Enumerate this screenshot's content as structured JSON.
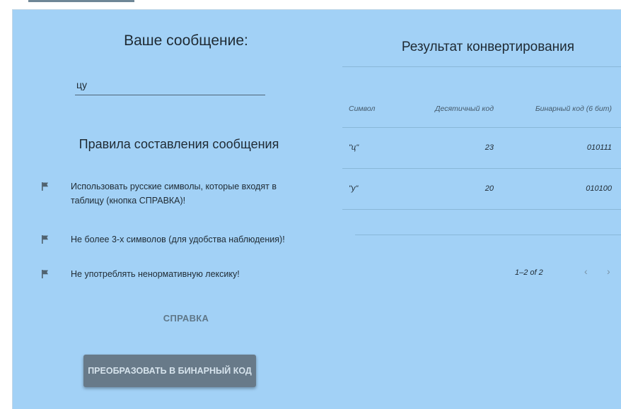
{
  "message": {
    "title": "Ваше сообщение:",
    "input_value": "цу"
  },
  "rules": {
    "title": "Правила составления сообщения",
    "items": [
      {
        "line1": "Использовать русские символы, которые входят в",
        "line2": "таблицу (кнопка СПРАВКА)!",
        "icon": "flag-icon"
      },
      {
        "line1": "Не более 3-х символов (для удобства наблюдения)!",
        "line2": "",
        "icon": "flag-icon"
      },
      {
        "line1": "Не употреблять ненормативную лексику!",
        "line2": "",
        "icon": "flag-icon"
      }
    ]
  },
  "buttons": {
    "help": "СПРАВКА",
    "convert": "ПРЕОБРАЗОВАТЬ В БИНАРНЫЙ КОД"
  },
  "result": {
    "title": "Результат конвертирования",
    "columns": [
      "Символ",
      "Десятичный код",
      "Бинарный код (6 бит)"
    ],
    "rows": [
      {
        "symbol": "\"ц\"",
        "decimal": "23",
        "binary": "010111"
      },
      {
        "symbol": "\"у\"",
        "decimal": "20",
        "binary": "010100"
      }
    ],
    "pagination": {
      "label": "1–2 of 2",
      "prev_icon": "chevron-left-icon",
      "next_icon": "chevron-right-icon"
    }
  },
  "colors": {
    "background": "#a2d1f6",
    "button": "#687a89",
    "flag": "#50626f"
  }
}
